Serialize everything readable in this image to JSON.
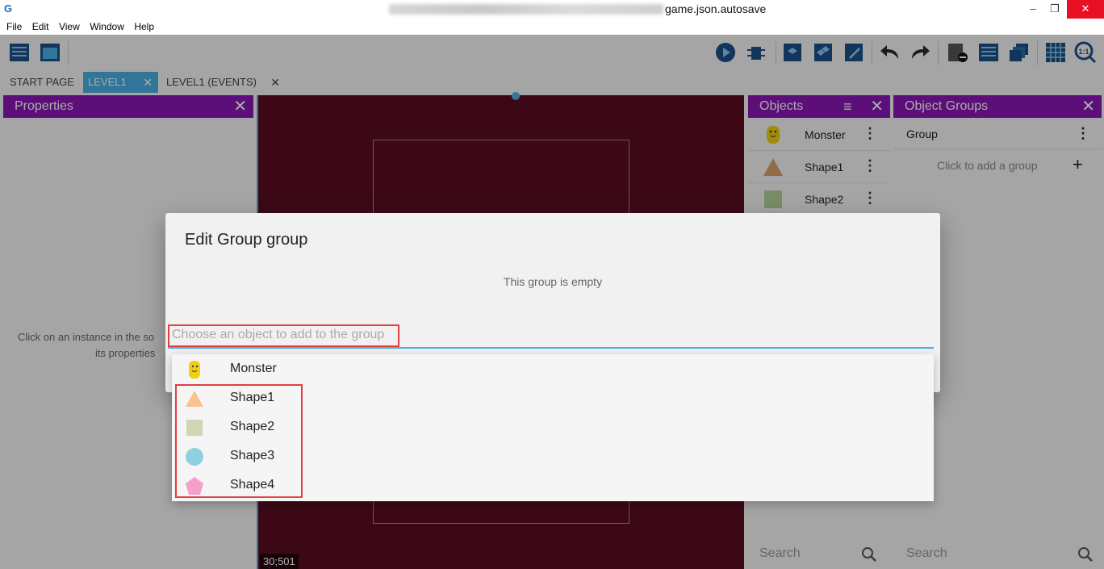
{
  "window": {
    "title": "game.json.autosave",
    "controls": {
      "minimize": "–",
      "maximize": "❐",
      "close": "✕"
    }
  },
  "menu": [
    "File",
    "Edit",
    "View",
    "Window",
    "Help"
  ],
  "tabs": [
    {
      "label": "START PAGE"
    },
    {
      "label": "LEVEL1"
    },
    {
      "label": "LEVEL1 (EVENTS)"
    }
  ],
  "tab_close": "✕",
  "properties_panel": {
    "title": "Properties",
    "hint_line1": "Click on an instance in the so",
    "hint_line2": "its properties"
  },
  "scene": {
    "coords": "30;501"
  },
  "objects_panel": {
    "title": "Objects",
    "items": [
      {
        "label": "Monster"
      },
      {
        "label": "Shape1"
      },
      {
        "label": "Shape2"
      }
    ],
    "search_placeholder": "Search"
  },
  "groups_panel": {
    "title": "Object Groups",
    "items": [
      {
        "label": "Group"
      }
    ],
    "add_label": "Click to add a group",
    "search_placeholder": "Search"
  },
  "dialog": {
    "title": "Edit Group group",
    "empty_text": "This group is empty",
    "input_placeholder": "Choose an object to add to the group",
    "options": [
      {
        "label": "Monster"
      },
      {
        "label": "Shape1"
      },
      {
        "label": "Shape2"
      },
      {
        "label": "Shape3"
      },
      {
        "label": "Shape4"
      }
    ]
  },
  "colors": {
    "panel_header": "#8a17b3",
    "accent": "#4ab0e4",
    "scene_bg": "#5a0d22",
    "highlight": "#e04040"
  }
}
